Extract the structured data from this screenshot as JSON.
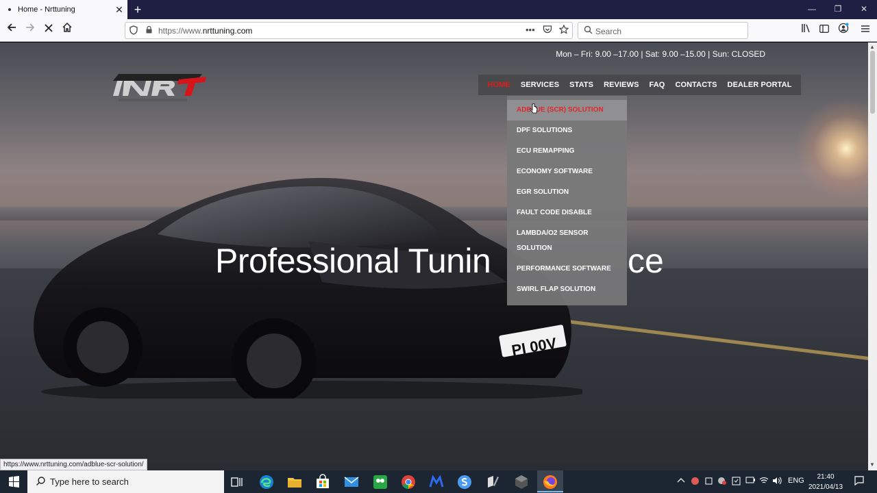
{
  "browser": {
    "tab_title": "Home - Nrttuning",
    "new_tab": "+",
    "url_prefix": "https://www.",
    "url_domain": "nrttuning.com",
    "search_placeholder": "Search",
    "more_dots": "•••",
    "window_min": "—",
    "window_restore": "❐",
    "window_close": "✕"
  },
  "site": {
    "hours": "Mon – Fri: 9.00 –17.00 | Sat: 9.00 –15.00 | Sun: CLOSED",
    "menu": [
      "HOME",
      "SERVICES",
      "STATS",
      "REVIEWS",
      "FAQ",
      "CONTACTS",
      "DEALER PORTAL"
    ],
    "active_menu": "HOME",
    "dropdown": [
      "ADBLUE (SCR) SOLUTION",
      "DPF SOLUTIONS",
      "ECU REMAPPING",
      "ECONOMY SOFTWARE",
      "EGR SOLUTION",
      "FAULT CODE DISABLE",
      "LAMBDA/O2 SENSOR SOLUTION",
      "PERFORMANCE SOFTWARE",
      "SWIRL FLAP SOLUTION"
    ],
    "hero_left": "Professional Tunin",
    "hero_right": "ce",
    "plate": "PI 00V",
    "accent": "#e01b1b"
  },
  "status_link": "https://www.nrttuning.com/adblue-scr-solution/",
  "taskbar": {
    "search_placeholder": "Type here to search",
    "lang": "ENG",
    "time": "21:40",
    "date": "2021/04/13"
  }
}
